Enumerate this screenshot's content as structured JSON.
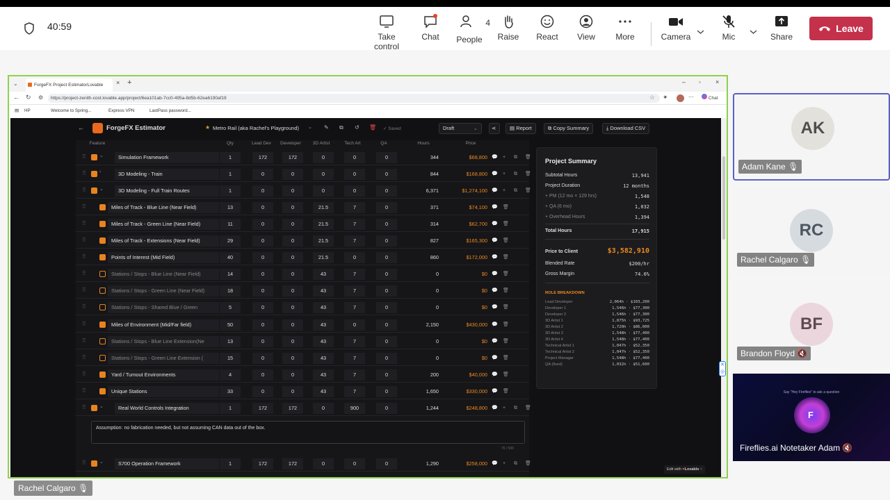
{
  "meeting": {
    "timer": "40:59",
    "buttons": {
      "take_control": "Take control",
      "chat": "Chat",
      "people": "People",
      "people_count": "4",
      "raise": "Raise",
      "react": "React",
      "view": "View",
      "more": "More",
      "camera": "Camera",
      "mic": "Mic",
      "share": "Share",
      "leave": "Leave"
    },
    "presenter_name": "Rachel Calgaro"
  },
  "browser": {
    "tab_title": "ForgeFX Project EstimatorLovable",
    "url": "https://project-zenith-cost.lovable.app/project/6ea101ab-7cc0-495a-8d5b-62ea6190af19",
    "bookmarks": [
      "HP",
      "Welcome to Spring...",
      "Express VPN",
      "LastPass password..."
    ],
    "chat_label": "Chat"
  },
  "app": {
    "title": "ForgeFX Estimator",
    "project_name": "Metro Rail (aka Rachel's Playground)",
    "saved": "Saved",
    "status_select": "Draft",
    "report": "Report",
    "copy_summary": "Copy Summary",
    "download_csv": "Download CSV",
    "edit_with": "Edit with",
    "lovable": "Lovable"
  },
  "table": {
    "headers": [
      "Feature",
      "Qty",
      "Lead Dev",
      "Developer",
      "3D Artist",
      "Tech Art",
      "QA",
      "Hours",
      "Price"
    ],
    "rows": [
      {
        "name": "Simulation Framework",
        "qty": "1",
        "lead": "172",
        "dev": "172",
        "art": "0",
        "tech": "0",
        "qa": "0",
        "hours": "344",
        "price": "$68,800"
      },
      {
        "name": "3D Modeling - Train",
        "qty": "1",
        "lead": "0",
        "dev": "0",
        "art": "0",
        "tech": "0",
        "qa": "0",
        "hours": "844",
        "price": "$168,800"
      },
      {
        "name": "3D Modeling - Full Train Routes",
        "qty": "1",
        "lead": "0",
        "dev": "0",
        "art": "0",
        "tech": "0",
        "qa": "0",
        "hours": "6,371",
        "price": "$1,274,100"
      },
      {
        "name": "Miles of Track - Blue Line (Near Field)",
        "qty": "13",
        "lead": "0",
        "dev": "0",
        "art": "21.5",
        "tech": "7",
        "qa": "0",
        "hours": "371",
        "price": "$74,100"
      },
      {
        "name": "Miles of Track - Green Line (Near Field)",
        "qty": "11",
        "lead": "0",
        "dev": "0",
        "art": "21.5",
        "tech": "7",
        "qa": "0",
        "hours": "314",
        "price": "$62,700"
      },
      {
        "name": "Miles of Track - Extensions (Near Field)",
        "qty": "29",
        "lead": "0",
        "dev": "0",
        "art": "21.5",
        "tech": "7",
        "qa": "0",
        "hours": "827",
        "price": "$165,300"
      },
      {
        "name": "Points of Interest (Mid Field)",
        "qty": "40",
        "lead": "0",
        "dev": "0",
        "art": "21.5",
        "tech": "0",
        "qa": "0",
        "hours": "860",
        "price": "$172,000"
      },
      {
        "name": "Stations / Stops - Blue Line (Near Field)",
        "qty": "14",
        "lead": "0",
        "dev": "0",
        "art": "43",
        "tech": "7",
        "qa": "0",
        "hours": "0",
        "price": "$0"
      },
      {
        "name": "Stations / Stops - Green Line (Near Field)",
        "qty": "18",
        "lead": "0",
        "dev": "0",
        "art": "43",
        "tech": "7",
        "qa": "0",
        "hours": "0",
        "price": "$0"
      },
      {
        "name": "Stations / Stops - Shared Blue / Green",
        "qty": "5",
        "lead": "0",
        "dev": "0",
        "art": "43",
        "tech": "7",
        "qa": "0",
        "hours": "0",
        "price": "$0"
      },
      {
        "name": "Miles of Environment (Mid/Far field)",
        "qty": "50",
        "lead": "0",
        "dev": "0",
        "art": "43",
        "tech": "0",
        "qa": "0",
        "hours": "2,150",
        "price": "$430,000"
      },
      {
        "name": "Stations / Stops - Blue Line Extension(Ne",
        "qty": "13",
        "lead": "0",
        "dev": "0",
        "art": "43",
        "tech": "7",
        "qa": "0",
        "hours": "0",
        "price": "$0"
      },
      {
        "name": "Stations / Stops - Green Line Extension (",
        "qty": "15",
        "lead": "0",
        "dev": "0",
        "art": "43",
        "tech": "7",
        "qa": "0",
        "hours": "0",
        "price": "$0"
      },
      {
        "name": "Yard / Turnout Environments",
        "qty": "4",
        "lead": "0",
        "dev": "0",
        "art": "43",
        "tech": "7",
        "qa": "0",
        "hours": "200",
        "price": "$40,000"
      },
      {
        "name": "Unique Stations",
        "qty": "33",
        "lead": "0",
        "dev": "0",
        "art": "43",
        "tech": "7",
        "qa": "0",
        "hours": "1,650",
        "price": "$330,000"
      },
      {
        "name": "Real World Controls Integration",
        "qty": "1",
        "lead": "172",
        "dev": "172",
        "art": "0",
        "tech": "900",
        "qa": "0",
        "hours": "1,244",
        "price": "$248,800"
      }
    ],
    "note": "Assumption: no fabrication needed, but not assuming CAN data out of the box.",
    "note_count": "76 / 500",
    "last_row": {
      "name": "S700 Operation Framework",
      "qty": "1",
      "lead": "172",
      "dev": "172",
      "art": "0",
      "tech": "0",
      "qa": "0",
      "hours": "1,290",
      "price": "$258,000"
    }
  },
  "summary": {
    "title": "Project Summary",
    "subtotal_label": "Subtotal Hours",
    "subtotal": "13,941",
    "duration_label": "Project Duration",
    "duration": "12 months",
    "pm_label": "+ PM (12 mo × 129 hrs)",
    "pm": "1,548",
    "qa_label": "+ QA (6 mo)",
    "qa": "1,032",
    "overhead_label": "+ Overhead Hours",
    "overhead": "1,394",
    "total_label": "Total Hours",
    "total": "17,915",
    "price_label": "Price to Client",
    "price": "$3,582,910",
    "blended_label": "Blended Rate",
    "blended": "$200/hr",
    "margin_label": "Gross Margin",
    "margin": "74.6%",
    "role_title": "ROLE BREAKDOWN",
    "roles": [
      {
        "name": "Lead Developer",
        "value": "2,064h · $103,200"
      },
      {
        "name": "Developer 1",
        "value": "1,546h · $77,300"
      },
      {
        "name": "Developer 2",
        "value": "1,546h · $77,300"
      },
      {
        "name": "3D Artist 1",
        "value": "1,875h · $93,725"
      },
      {
        "name": "3D Artist 2",
        "value": "1,720h · $86,000"
      },
      {
        "name": "3D Artist 3",
        "value": "1,548h · $77,400"
      },
      {
        "name": "3D Artist 4",
        "value": "1,548h · $77,400"
      },
      {
        "name": "Technical Artist 1",
        "value": "1,047h · $52,350"
      },
      {
        "name": "Technical Artist 2",
        "value": "1,047h · $52,350"
      },
      {
        "name": "Project Manager",
        "value": "1,548h · $77,400"
      },
      {
        "name": "QA (fixed)",
        "value": "1,032h · $51,600"
      }
    ]
  },
  "participants": [
    {
      "initials": "AK",
      "name": "Adam Kane"
    },
    {
      "initials": "RC",
      "name": "Rachel Calgaro"
    },
    {
      "initials": "BF",
      "name": "Brandon Floyd"
    },
    {
      "initials": "",
      "name": "Fireflies.ai Notetaker Adam",
      "caption": "Say \"Hey Fireflies\" to ask a question"
    }
  ],
  "colors": {
    "accent": "#e8831f",
    "leave": "#c4314b",
    "share_border": "#8fd14f",
    "active_tile": "#5b5fc7"
  }
}
